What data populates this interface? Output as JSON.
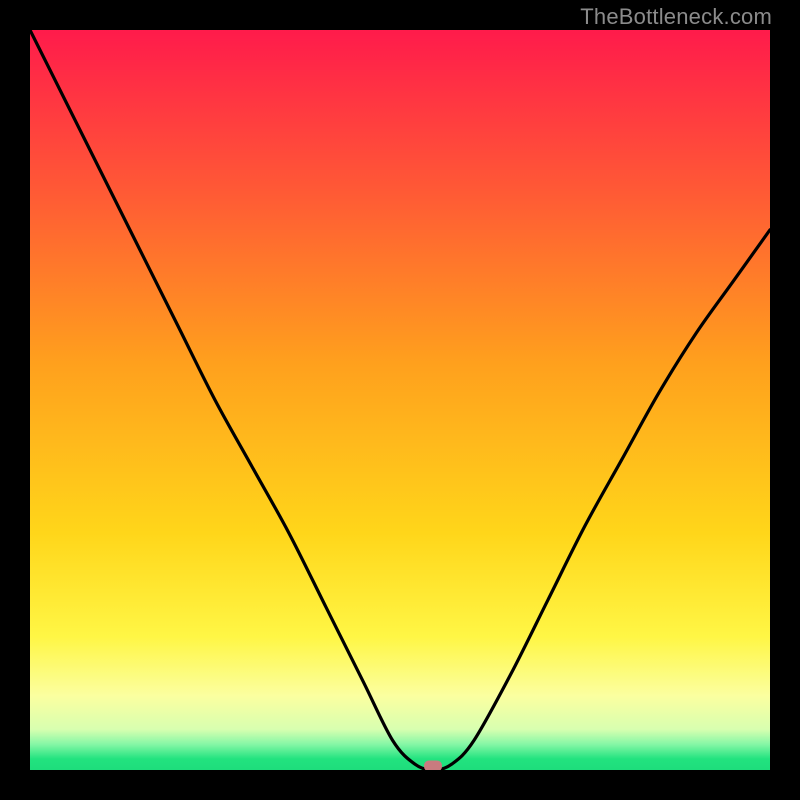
{
  "watermark": "TheBottleneck.com",
  "colors": {
    "frame": "#000000",
    "marker": "#c97b7f",
    "curve": "#000000",
    "gradient_stops": [
      {
        "offset": 0.0,
        "color": "#ff1b4b"
      },
      {
        "offset": 0.22,
        "color": "#ff5a35"
      },
      {
        "offset": 0.45,
        "color": "#ffa01d"
      },
      {
        "offset": 0.68,
        "color": "#ffd61a"
      },
      {
        "offset": 0.82,
        "color": "#fff645"
      },
      {
        "offset": 0.9,
        "color": "#fbffa0"
      },
      {
        "offset": 0.945,
        "color": "#d8ffb0"
      },
      {
        "offset": 0.965,
        "color": "#86f7a6"
      },
      {
        "offset": 0.985,
        "color": "#22e37f"
      },
      {
        "offset": 1.0,
        "color": "#1edd7c"
      }
    ]
  },
  "chart_data": {
    "type": "line",
    "title": "",
    "xlabel": "",
    "ylabel": "",
    "xlim": [
      0,
      1
    ],
    "ylim": [
      0,
      1
    ],
    "min_point": {
      "x": 0.545,
      "y": 0.0
    },
    "series": [
      {
        "name": "bottleneck-curve",
        "x": [
          0.0,
          0.05,
          0.1,
          0.15,
          0.2,
          0.25,
          0.3,
          0.35,
          0.4,
          0.45,
          0.49,
          0.52,
          0.545,
          0.57,
          0.6,
          0.65,
          0.7,
          0.75,
          0.8,
          0.85,
          0.9,
          0.95,
          1.0
        ],
        "y": [
          1.0,
          0.9,
          0.8,
          0.7,
          0.6,
          0.5,
          0.41,
          0.32,
          0.22,
          0.12,
          0.04,
          0.008,
          0.0,
          0.008,
          0.04,
          0.13,
          0.23,
          0.33,
          0.42,
          0.51,
          0.59,
          0.66,
          0.73
        ]
      }
    ]
  }
}
